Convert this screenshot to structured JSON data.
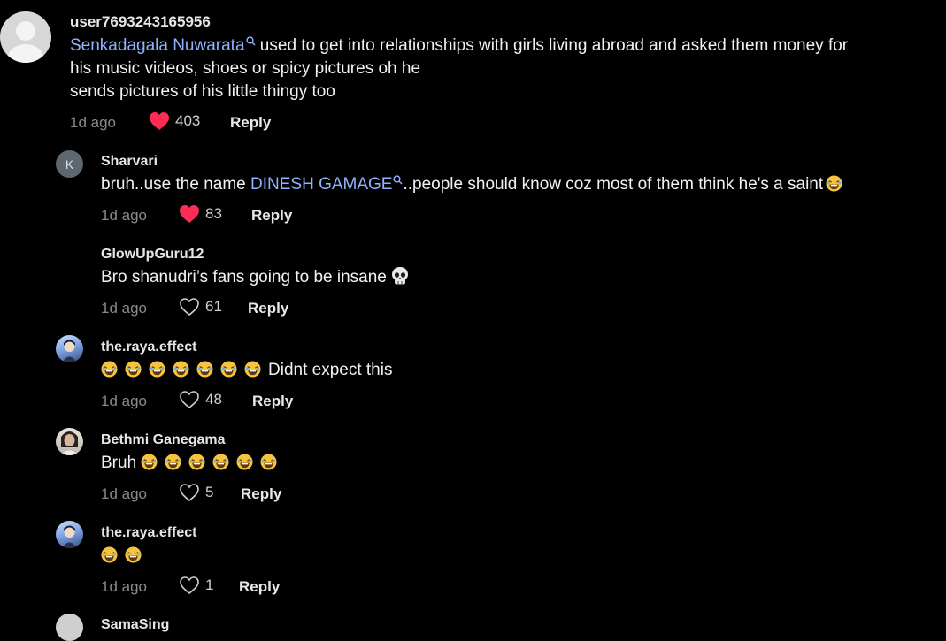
{
  "comments": [
    {
      "username": "user7693243165956",
      "mention": "Senkadagala Nuwarata",
      "text_after_mention_line1": " used to get into relationships with girls living abroad and asked them money for",
      "text_line2": "his music videos, shoes or spicy pictures oh he",
      "text_line3": "sends pictures of his little thingy too",
      "time": "1d ago",
      "likes": "403",
      "liked": true,
      "reply_label": "Reply"
    },
    {
      "username": "Sharvari",
      "avatar_letter": "K",
      "text_before_mention": "bruh..use the name ",
      "mention": "DINESH GAMAGE",
      "text_after_mention": "..people should know coz most of them think he's a saint",
      "time": "1d ago",
      "likes": "83",
      "liked": true,
      "reply_label": "Reply"
    },
    {
      "username": "GlowUpGuru12",
      "text": "Bro shanudri’s fans going to be insane",
      "time": "1d ago",
      "likes": "61",
      "liked": false,
      "reply_label": "Reply"
    },
    {
      "username": "the.raya.effect",
      "text": "Didnt expect this",
      "emoji_count": 7,
      "time": "1d ago",
      "likes": "48",
      "liked": false,
      "reply_label": "Reply"
    },
    {
      "username": "Bethmi Ganegama",
      "text": "Bruh",
      "emoji_count": 6,
      "time": "1d ago",
      "likes": "5",
      "liked": false,
      "reply_label": "Reply"
    },
    {
      "username": "the.raya.effect",
      "text": "",
      "emoji_count": 2,
      "time": "1d ago",
      "likes": "1",
      "liked": false,
      "reply_label": "Reply"
    },
    {
      "username": "SamaSing"
    }
  ],
  "colors": {
    "background": "#000000",
    "mention": "#8fb4ff",
    "liked_heart": "#fe2c55",
    "muted": "#8a8a8a"
  },
  "icons": {
    "heart": "heart-icon",
    "search_small": "search-icon",
    "laughing_emoji": "laughing-emoji-icon",
    "skull_emoji": "skull-emoji-icon"
  }
}
